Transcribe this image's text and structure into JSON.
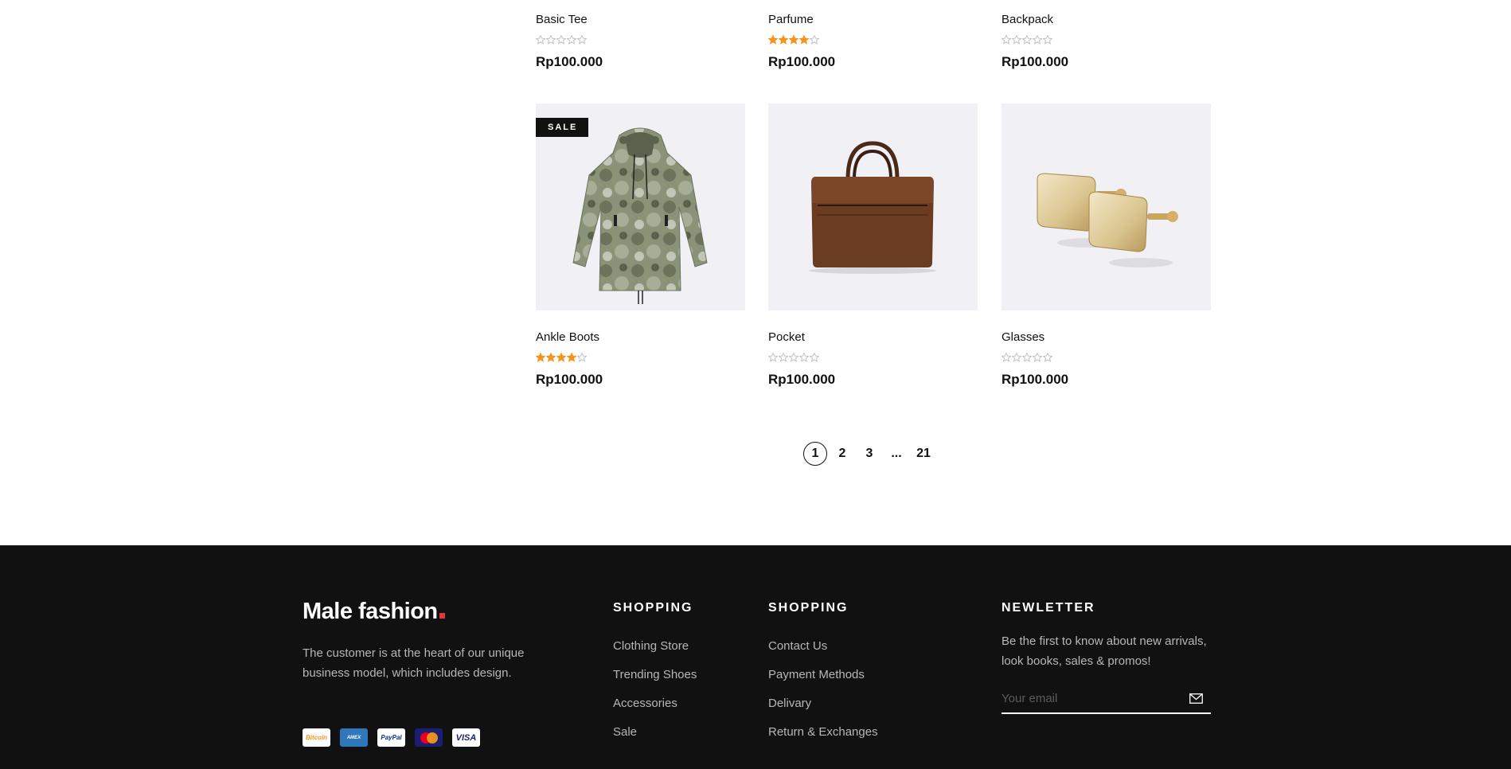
{
  "products": [
    {
      "name": "Basic Tee",
      "rating": 0,
      "price": "Rp100.000",
      "sale": false
    },
    {
      "name": "Parfume",
      "rating": 4,
      "price": "Rp100.000",
      "sale": false
    },
    {
      "name": "Backpack",
      "rating": 0,
      "price": "Rp100.000",
      "sale": false
    },
    {
      "name": "Ankle Boots",
      "rating": 4,
      "price": "Rp100.000",
      "sale": true,
      "badge": "SALE",
      "image": "camo-jacket"
    },
    {
      "name": "Pocket",
      "rating": 0,
      "price": "Rp100.000",
      "sale": false,
      "image": "leather-bag"
    },
    {
      "name": "Glasses",
      "rating": 0,
      "price": "Rp100.000",
      "sale": false,
      "image": "cufflinks"
    }
  ],
  "pagination": {
    "pages": [
      "1",
      "2",
      "3",
      "...",
      "21"
    ],
    "current": "1"
  },
  "footer": {
    "logo": "Male fashion",
    "about": "The customer is at the heart of our unique business model, which includes design.",
    "payments": [
      "bitcoin",
      "American Express",
      "PayPal",
      "MasterCard",
      "VISA"
    ],
    "col1": {
      "title": "SHOPPING",
      "links": [
        "Clothing Store",
        "Trending Shoes",
        "Accessories",
        "Sale"
      ]
    },
    "col2": {
      "title": "SHOPPING",
      "links": [
        "Contact Us",
        "Payment Methods",
        "Delivary",
        "Return & Exchanges"
      ]
    },
    "newsletter": {
      "title": "NEWLETTER",
      "text": "Be the first to know about new arrivals, look books, sales & promos!",
      "placeholder": "Your email"
    }
  },
  "colors": {
    "star_filled": "#f7941d",
    "star_empty": "#bdbdbd",
    "footer_bg": "#111111",
    "accent": "#e53637",
    "image_bg": "#f0f0f5"
  }
}
